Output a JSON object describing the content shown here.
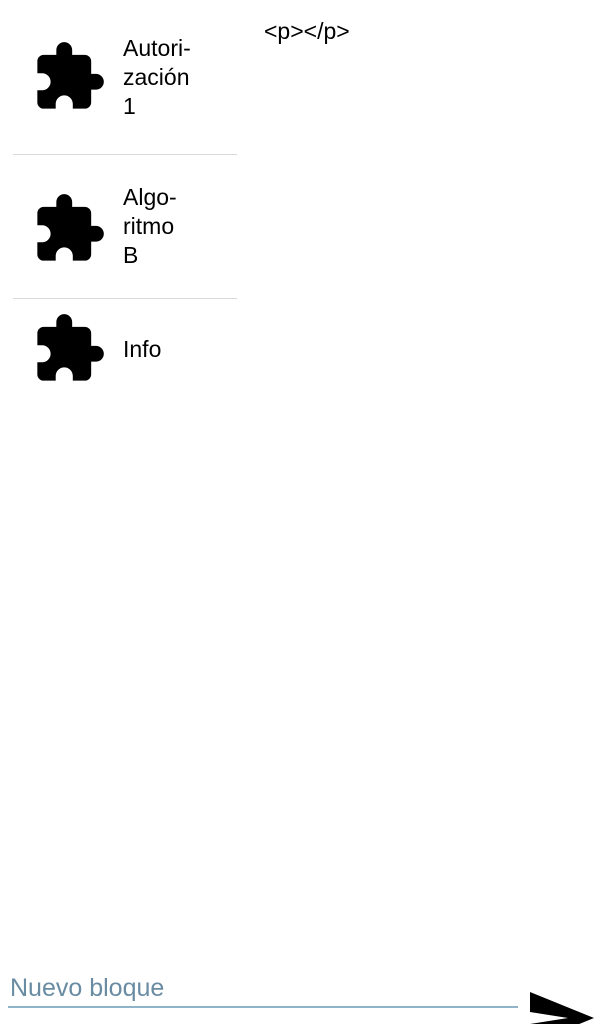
{
  "blocks": [
    {
      "label": "Autori-\nzación\n1",
      "icon": "puzzle-piece-icon"
    },
    {
      "label": "Algo-\nritmo\nB",
      "icon": "puzzle-piece-icon"
    },
    {
      "label": "Info",
      "icon": "puzzle-piece-icon"
    }
  ],
  "content": {
    "preview_text": "<p></p>"
  },
  "footer": {
    "input_value": "",
    "input_placeholder": "Nuevo bloque",
    "send_icon": "send-icon"
  },
  "colors": {
    "divider": "#d9d9d9",
    "input_underline": "#8fb3c9",
    "placeholder": "#6a8ca3",
    "icon": "#000000"
  }
}
